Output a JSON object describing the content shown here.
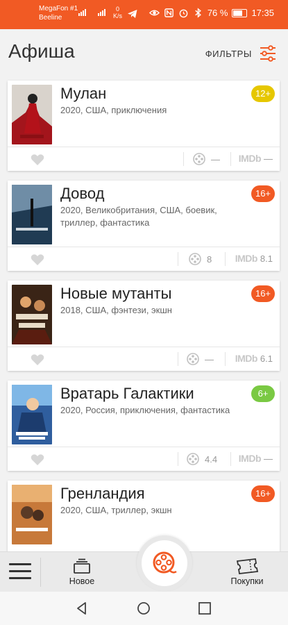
{
  "status_bar": {
    "carrier_1": "MegaFon #1",
    "carrier_2": "Beeline",
    "net_speed_value": "0",
    "net_speed_unit": "K/s",
    "signal_tag": "4G",
    "battery_percent": "76 %",
    "time": "17:35",
    "bar_color": "#f15a24"
  },
  "header": {
    "title": "Афиша",
    "filter_label": "ФИЛЬТРЫ"
  },
  "movies": [
    {
      "title": "Мулан",
      "meta": "2020, США, приключения",
      "age": "12+",
      "age_color": "#e6c700",
      "cinema_count": "—",
      "imdb": "—"
    },
    {
      "title": "Довод",
      "meta": "2020, Великобритания, США, боевик, триллер, фантастика",
      "age": "16+",
      "age_color": "#f15a24",
      "cinema_count": "8",
      "imdb": "8.1"
    },
    {
      "title": "Новые мутанты",
      "meta": "2018, США, фэнтези, экшн",
      "age": "16+",
      "age_color": "#f15a24",
      "cinema_count": "—",
      "imdb": "6.1"
    },
    {
      "title": "Вратарь Галактики",
      "meta": "2020, Россия, приключения, фантастика",
      "age": "6+",
      "age_color": "#7ac943",
      "cinema_count": "4.4",
      "imdb": "—"
    },
    {
      "title": "Гренландия",
      "meta": "2020, США, триллер, экшн",
      "age": "16+",
      "age_color": "#f15a24",
      "cinema_count": "",
      "imdb": ""
    }
  ],
  "imdb_label": "IMDb",
  "bottom_nav": {
    "new_label": "Новое",
    "purchases_label": "Покупки"
  },
  "accent_color": "#f15a24"
}
